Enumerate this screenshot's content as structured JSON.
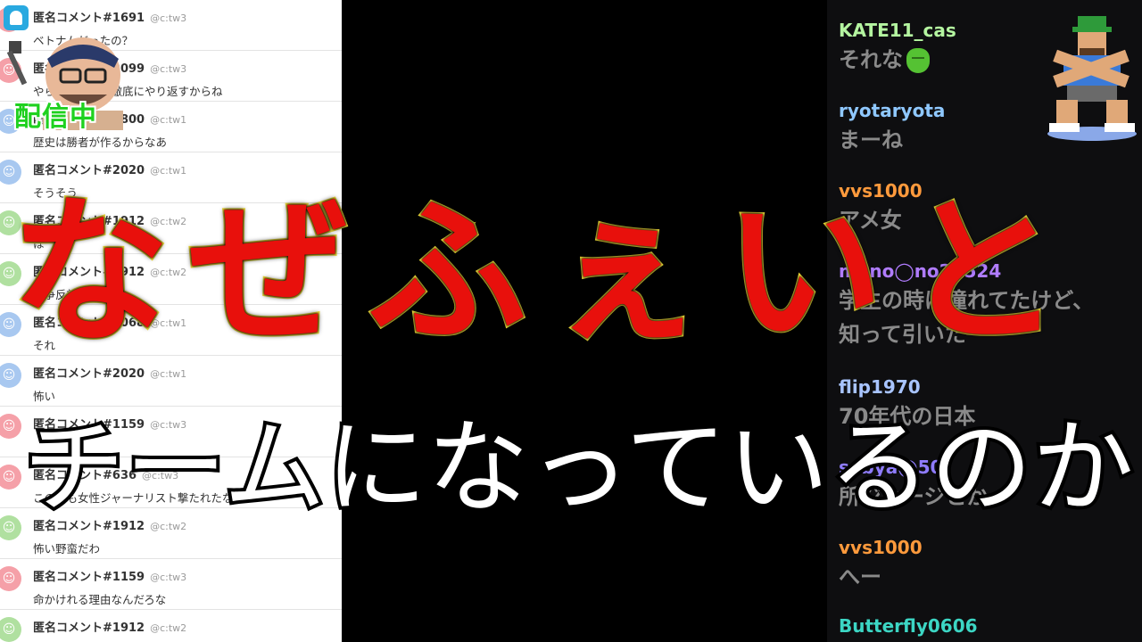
{
  "left_panel": {
    "rows": [
      {
        "name": "匿名コメント#1691",
        "id": "@c:tw3",
        "text": "ベトナムだったの？",
        "face_color": "#f5a0a8",
        "face_icon": "smiley-icon"
      },
      {
        "name": "匿名コメント#2099",
        "id": "@c:tw3",
        "text": "やられた喧嘩は徹底にやり返すからね",
        "face_color": "#f5a0a8",
        "face_icon": "smiley-icon"
      },
      {
        "name": "匿名コメント#1800",
        "id": "@c:tw1",
        "text": "歴史は勝者が作るからなあ",
        "face_color": "#a8c8f0",
        "face_icon": "smiley-icon"
      },
      {
        "name": "匿名コメント#2020",
        "id": "@c:tw1",
        "text": "そうそう",
        "face_color": "#a8c8f0",
        "face_icon": "smiley-icon"
      },
      {
        "name": "匿名コメント#1912",
        "id": "@c:tw2",
        "text": "ほ",
        "face_color": "#b0e0a0",
        "face_icon": "smiley-icon"
      },
      {
        "name": "匿名コメント#1912",
        "id": "@c:tw2",
        "text": "戦争反対",
        "face_color": "#b0e0a0",
        "face_icon": "smiley-icon"
      },
      {
        "name": "匿名コメント#1068",
        "id": "@c:tw1",
        "text": "それ",
        "face_color": "#a8c8f0",
        "face_icon": "smiley-icon"
      },
      {
        "name": "匿名コメント#2020",
        "id": "@c:tw1",
        "text": "怖い",
        "face_color": "#a8c8f0",
        "face_icon": "smiley-icon"
      },
      {
        "name": "匿名コメント#1159",
        "id": "@c:tw3",
        "text": "",
        "face_color": "#f5a0a8",
        "face_icon": "smiley-icon"
      },
      {
        "name": "匿名コメント#636",
        "id": "@c:tw3",
        "text": "この前も女性ジャーナリスト撃たれたな",
        "face_color": "#f5a0a8",
        "face_icon": "smiley-icon"
      },
      {
        "name": "匿名コメント#1912",
        "id": "@c:tw2",
        "text": "怖い野蛮だわ",
        "face_color": "#b0e0a0",
        "face_icon": "smiley-icon"
      },
      {
        "name": "匿名コメント#1159",
        "id": "@c:tw3",
        "text": "命かけれる理由なんだろな",
        "face_color": "#f5a0a8",
        "face_icon": "smiley-icon"
      },
      {
        "name": "匿名コメント#1912",
        "id": "@c:tw2",
        "text": "",
        "face_color": "#b0e0a0",
        "face_icon": "smiley-icon"
      }
    ]
  },
  "overlay": {
    "live_label": "配信中",
    "live_color": "#1fd11f"
  },
  "chat": {
    "messages": [
      {
        "user": "KATE11_cas",
        "text": "それな",
        "color": "#b4f5a0",
        "emote": "green-blob-emote"
      },
      {
        "user": "ryotaryota",
        "text": "まーね",
        "color": "#8fc8ff"
      },
      {
        "user": "vvs1000",
        "text": "アメ女",
        "color": "#ff9a3c"
      },
      {
        "user": "mano◯no24524",
        "text": "学生の時は憧れてたけど、",
        "text2": "知って引いた一",
        "color": "#b07cff"
      },
      {
        "user": "flip1970",
        "text": "70年代の日本",
        "color": "#a8c4ff"
      },
      {
        "user": "sabya◯50",
        "text": "所ジョージとか",
        "color": "#8f7cff"
      },
      {
        "user": "vvs1000",
        "text": "へー",
        "color": "#ff9a3c"
      },
      {
        "user": "Butterfly0606",
        "text": "",
        "color": "#3cd6c4"
      }
    ]
  },
  "caption": {
    "line1": "なぜふぇいと",
    "line2": "チームになっているのか",
    "line1_color": "#e8100c",
    "line1_outline": "#f5e03b",
    "line2_color": "#ffffff"
  }
}
